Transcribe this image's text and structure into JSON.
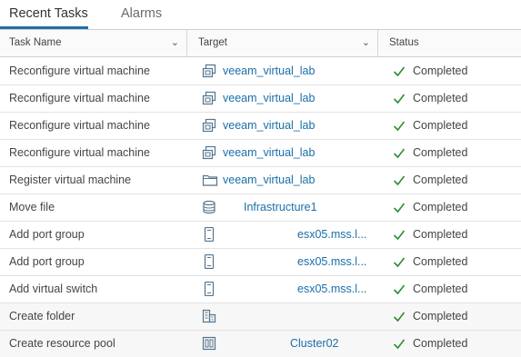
{
  "tabs": [
    {
      "label": "Recent Tasks",
      "active": true
    },
    {
      "label": "Alarms",
      "active": false
    }
  ],
  "columns": {
    "task": "Task Name",
    "target": "Target",
    "status": "Status"
  },
  "icon_colors": {
    "accent": "#1f6eab",
    "link": "#1a6fa8",
    "success": "#2e8c2e"
  },
  "rows": [
    {
      "task": "Reconfigure virtual machine",
      "target": "veeam_virtual_lab",
      "target_icon": "vm-icon",
      "status": "Completed"
    },
    {
      "task": "Reconfigure virtual machine",
      "target": "veeam_virtual_lab",
      "target_icon": "vm-icon",
      "status": "Completed"
    },
    {
      "task": "Reconfigure virtual machine",
      "target": "veeam_virtual_lab",
      "target_icon": "vm-icon",
      "status": "Completed"
    },
    {
      "task": "Reconfigure virtual machine",
      "target": "veeam_virtual_lab",
      "target_icon": "vm-icon",
      "status": "Completed"
    },
    {
      "task": "Register virtual machine",
      "target": "veeam_virtual_lab",
      "target_icon": "folder-icon",
      "status": "Completed"
    },
    {
      "task": "Move file",
      "target": "Infrastructure1",
      "target_icon": "datastore-icon",
      "status": "Completed"
    },
    {
      "task": "Add port group",
      "target": "esx05.mss.l...",
      "target_icon": "host-icon",
      "status": "Completed"
    },
    {
      "task": "Add port group",
      "target": "esx05.mss.l...",
      "target_icon": "host-icon",
      "status": "Completed"
    },
    {
      "task": "Add virtual switch",
      "target": "esx05.mss.l...",
      "target_icon": "host-icon",
      "status": "Completed"
    },
    {
      "task": "Create folder",
      "target": "",
      "target_icon": "datacenter-icon",
      "status": "Completed"
    },
    {
      "task": "Create resource pool",
      "target": "Cluster02",
      "target_icon": "cluster-icon",
      "status": "Completed"
    }
  ]
}
